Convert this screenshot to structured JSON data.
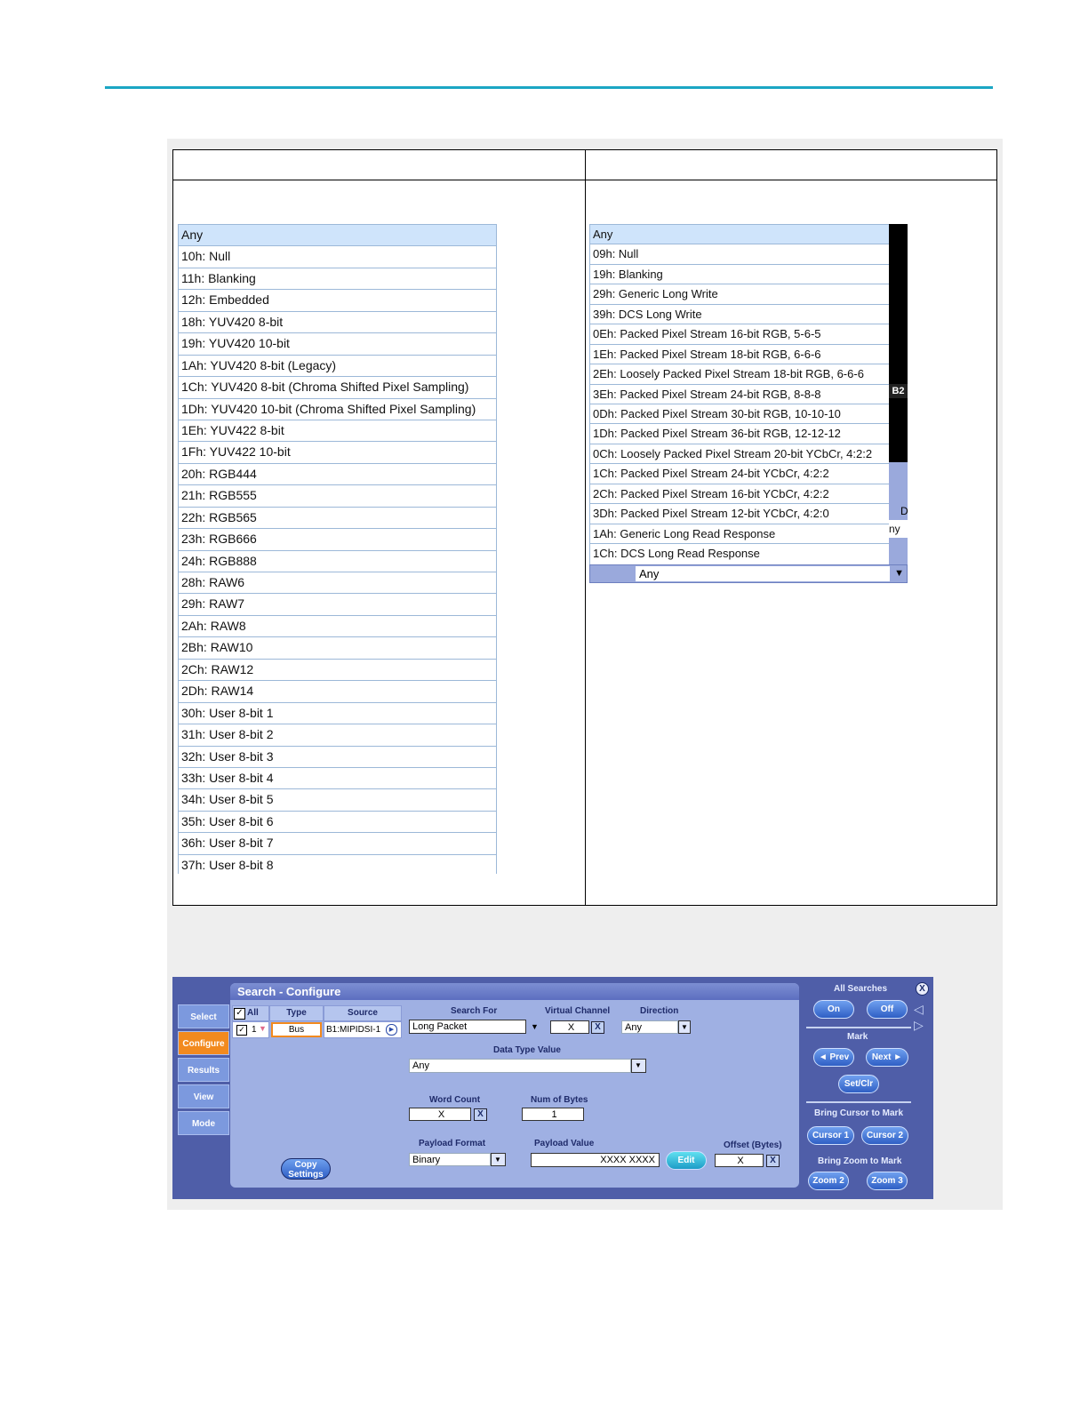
{
  "left_list": {
    "items": [
      "Any",
      "10h: Null",
      "11h: Blanking",
      "12h: Embedded",
      "18h: YUV420 8-bit",
      "19h: YUV420 10-bit",
      "1Ah: YUV420 8-bit (Legacy)",
      "1Ch: YUV420 8-bit (Chroma Shifted Pixel Sampling)",
      "1Dh: YUV420 10-bit (Chroma Shifted Pixel Sampling)",
      "1Eh: YUV422 8-bit",
      "1Fh: YUV422 10-bit",
      "20h: RGB444",
      "21h: RGB555",
      "22h: RGB565",
      "23h: RGB666",
      "24h: RGB888",
      "28h: RAW6",
      "29h: RAW7",
      "2Ah: RAW8",
      "2Bh: RAW10",
      "2Ch: RAW12",
      "2Dh: RAW14",
      "30h: User 8-bit 1",
      "31h: User 8-bit 2",
      "32h: User 8-bit 3",
      "33h: User 8-bit 4",
      "34h: User 8-bit 5",
      "35h: User 8-bit 6",
      "36h: User 8-bit 7",
      "37h: User 8-bit 8"
    ]
  },
  "right_list": {
    "items": [
      "Any",
      "09h: Null",
      "19h: Blanking",
      "29h: Generic Long Write",
      "39h: DCS Long Write",
      "0Eh: Packed Pixel Stream 16-bit RGB, 5-6-5",
      "1Eh: Packed Pixel Stream 18-bit RGB, 6-6-6",
      "2Eh: Loosely Packed Pixel Stream 18-bit RGB, 6-6-6",
      "3Eh: Packed Pixel Stream 24-bit RGB, 8-8-8",
      "0Dh: Packed Pixel Stream 30-bit RGB, 10-10-10",
      "1Dh: Packed Pixel Stream 36-bit RGB, 12-12-12",
      "0Ch: Loosely Packed Pixel Stream 20-bit YCbCr, 4:2:2",
      "1Ch: Packed Pixel Stream 24-bit YCbCr, 4:2:2",
      "2Ch: Packed Pixel Stream 16-bit YCbCr, 4:2:2",
      "3Dh: Packed Pixel Stream 12-bit YCbCr, 4:2:0",
      "1Ah: Generic Long Read Response",
      "1Ch: DCS Long Read Response"
    ],
    "combo_value": "Any",
    "scope_label": "B2",
    "scope_letter": "D",
    "scope_partial": "ny"
  },
  "search_configure": {
    "title": "Search - Configure",
    "nav": [
      "Select",
      "Configure",
      "Results",
      "View",
      "Mode"
    ],
    "table": {
      "all_label": "All",
      "type_header": "Type",
      "source_header": "Source",
      "row_number": "1",
      "type_value": "Bus",
      "source_value": "B1:MIPIDSI-1"
    },
    "search_for": {
      "label": "Search For",
      "value": "Long Packet"
    },
    "virtual_channel": {
      "label": "Virtual Channel",
      "value": "X",
      "x_button": "X"
    },
    "direction": {
      "label": "Direction",
      "value": "Any"
    },
    "data_type_value": {
      "label": "Data Type Value",
      "value": "Any"
    },
    "word_count": {
      "label": "Word Count",
      "value": "X",
      "x_button": "X"
    },
    "num_bytes": {
      "label": "Num of Bytes",
      "value": "1"
    },
    "payload_format": {
      "label": "Payload Format",
      "value": "Binary"
    },
    "payload_value": {
      "label": "Payload Value",
      "value": "XXXX XXXX"
    },
    "edit_button": "Edit",
    "offset": {
      "label": "Offset (Bytes)",
      "value": "X",
      "x_button": "X"
    },
    "copy_settings": "Copy Settings",
    "right": {
      "close": "X",
      "all_searches": "All Searches",
      "on": "On",
      "off": "Off",
      "mark": "Mark",
      "prev": "◄ Prev",
      "next": "Next ►",
      "set_clr": "Set/Clr",
      "bring_cursor": "Bring Cursor to Mark",
      "cursor1": "Cursor 1",
      "cursor2": "Cursor 2",
      "bring_zoom": "Bring Zoom to Mark",
      "zoom2": "Zoom 2",
      "zoom3": "Zoom 3"
    }
  },
  "colors": {
    "accent_line": "#1ba6c4",
    "panel_bg": "#4f5ea8",
    "active_tab": "#f28a1e"
  }
}
